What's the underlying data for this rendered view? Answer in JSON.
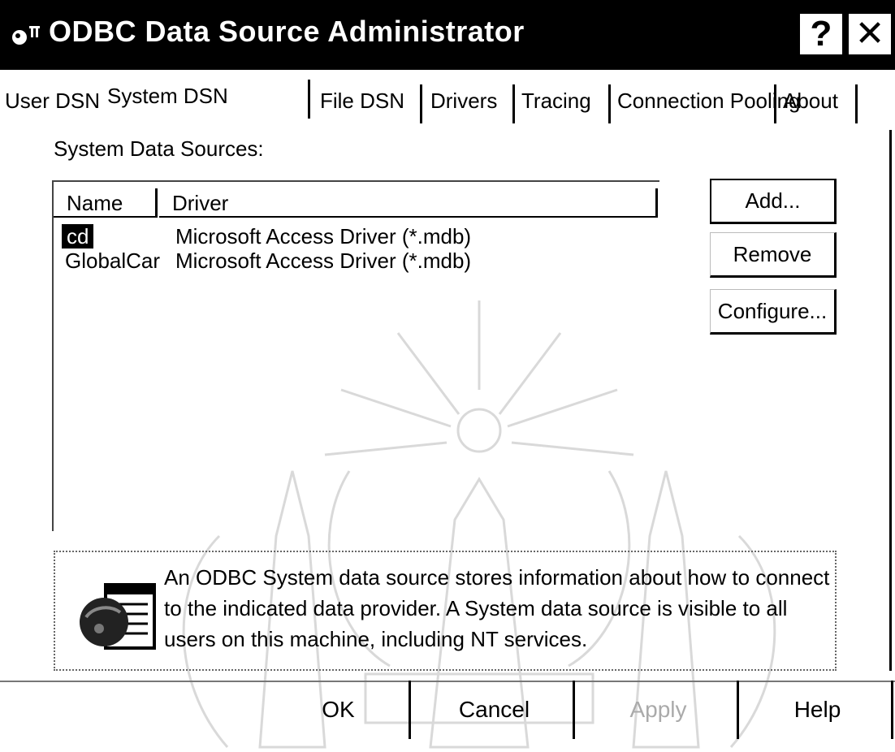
{
  "window": {
    "title": "ODBC Data Source Administrator",
    "help_glyph": "?",
    "close_glyph": "✕"
  },
  "tabs": [
    {
      "label": "User DSN",
      "active": false
    },
    {
      "label": "System DSN",
      "active": true
    },
    {
      "label": "File DSN",
      "active": false
    },
    {
      "label": "Drivers",
      "active": false
    },
    {
      "label": "Tracing",
      "active": false
    },
    {
      "label": "Connection Pooling",
      "active": false
    },
    {
      "label": "About",
      "active": false
    }
  ],
  "system_dsn": {
    "group_label": "System Data Sources:",
    "columns": [
      "Name",
      "Driver"
    ],
    "rows": [
      {
        "name": "cd",
        "driver": "Microsoft Access Driver (*.mdb)",
        "selected": true
      },
      {
        "name": "GlobalCar",
        "driver": "Microsoft Access Driver (*.mdb)",
        "selected": false
      }
    ],
    "buttons": {
      "add": "Add...",
      "remove": "Remove",
      "configure": "Configure..."
    },
    "info_text": "An ODBC System data source stores information about how to connect to the indicated data provider.   A System data source is visible to all users on this machine, including NT services."
  },
  "footer": {
    "ok": "OK",
    "cancel": "Cancel",
    "apply": "Apply",
    "help": "Help"
  },
  "icons": {
    "app": "odbc-app-icon",
    "info": "database-info-icon",
    "watermark": "university-seal-watermark"
  },
  "colors": {
    "titlebar": "#000000",
    "background": "#ffffff",
    "disabled_text": "#aaaaaa"
  }
}
